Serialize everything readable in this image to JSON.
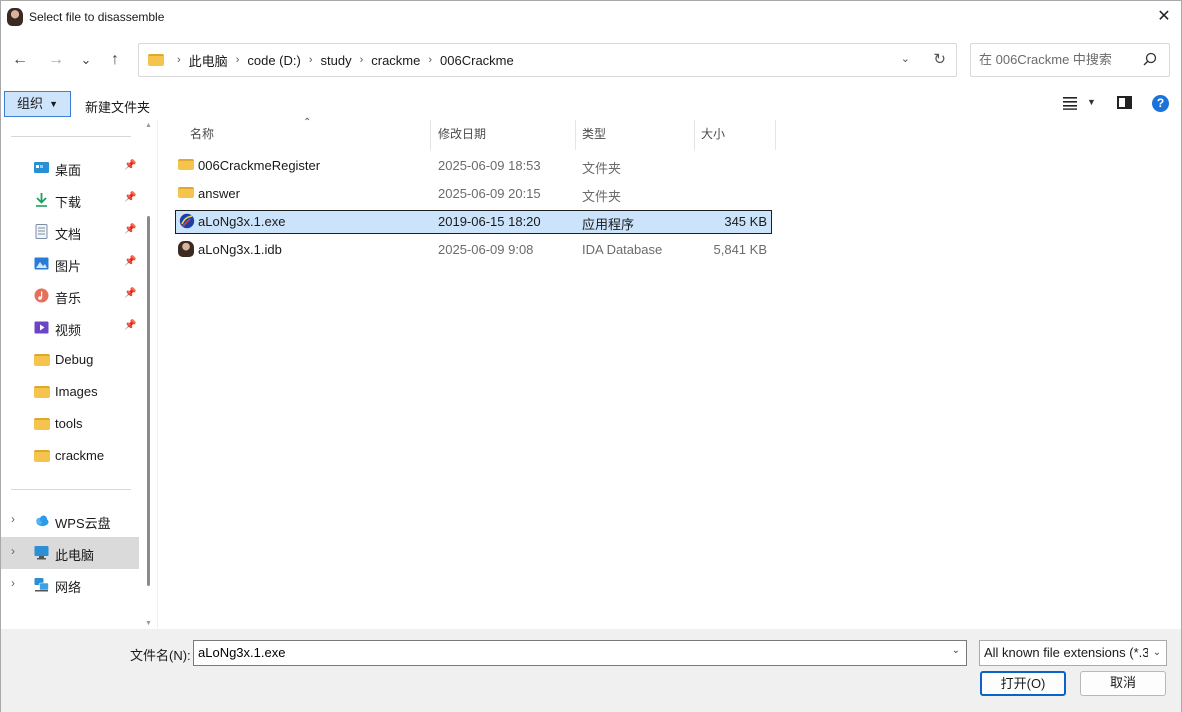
{
  "window": {
    "title": "Select file to disassemble",
    "close_label": "✕"
  },
  "nav": {
    "back": "←",
    "forward": "→",
    "recent": "⌄",
    "up": "↑",
    "breadcrumbs": [
      "此电脑",
      "code (D:)",
      "study",
      "crackme",
      "006Crackme"
    ],
    "breadcrumb_sep": "›",
    "dropdown": "⌄",
    "refresh": "↻",
    "search_placeholder": "在 006Crackme 中搜索"
  },
  "toolbar": {
    "organize": "组织",
    "organize_caret": "▼",
    "new_folder": "新建文件夹",
    "view_caret": "▼",
    "help": "?"
  },
  "sidebar": {
    "quick": [
      {
        "label": "桌面",
        "icon": "desktop-icon",
        "pinned": true
      },
      {
        "label": "下载",
        "icon": "download-icon",
        "pinned": true
      },
      {
        "label": "文档",
        "icon": "document-icon",
        "pinned": true
      },
      {
        "label": "图片",
        "icon": "pictures-icon",
        "pinned": true
      },
      {
        "label": "音乐",
        "icon": "music-icon",
        "pinned": true
      },
      {
        "label": "视频",
        "icon": "video-icon",
        "pinned": true
      },
      {
        "label": "Debug",
        "icon": "folder-icon",
        "pinned": false
      },
      {
        "label": "Images",
        "icon": "folder-icon",
        "pinned": false
      },
      {
        "label": "tools",
        "icon": "folder-icon",
        "pinned": false
      },
      {
        "label": "crackme",
        "icon": "folder-icon",
        "pinned": false
      }
    ],
    "pin_glyph": "📌",
    "locations": [
      {
        "label": "WPS云盘",
        "icon": "cloud-icon",
        "active": false
      },
      {
        "label": "此电脑",
        "icon": "computer-icon",
        "active": true
      },
      {
        "label": "网络",
        "icon": "network-icon",
        "active": false
      }
    ],
    "expand_glyph": "›"
  },
  "columns": {
    "name": "名称",
    "modified": "修改日期",
    "type": "类型",
    "size": "大小",
    "sort_glyph": "⌃"
  },
  "files": [
    {
      "name": "006CrackmeRegister",
      "modified": "2025-06-09 18:53",
      "type": "文件夹",
      "size": "",
      "icon": "folder-icon",
      "selected": false
    },
    {
      "name": "answer",
      "modified": "2025-06-09 20:15",
      "type": "文件夹",
      "size": "",
      "icon": "folder-icon",
      "selected": false
    },
    {
      "name": "aLoNg3x.1.exe",
      "modified": "2019-06-15 18:20",
      "type": "应用程序",
      "size": "345 KB",
      "icon": "application-icon",
      "selected": true
    },
    {
      "name": "aLoNg3x.1.idb",
      "modified": "2025-06-09 9:08",
      "type": "IDA Database",
      "size": "5,841 KB",
      "icon": "ida-database-icon",
      "selected": false
    }
  ],
  "bottom": {
    "filename_label": "文件名(N):",
    "filename_value": "aLoNg3x.1.exe",
    "filter_value": "All known file extensions (*.3",
    "open_button": "打开(O)",
    "cancel_button": "取消",
    "dropdown": "⌄"
  }
}
